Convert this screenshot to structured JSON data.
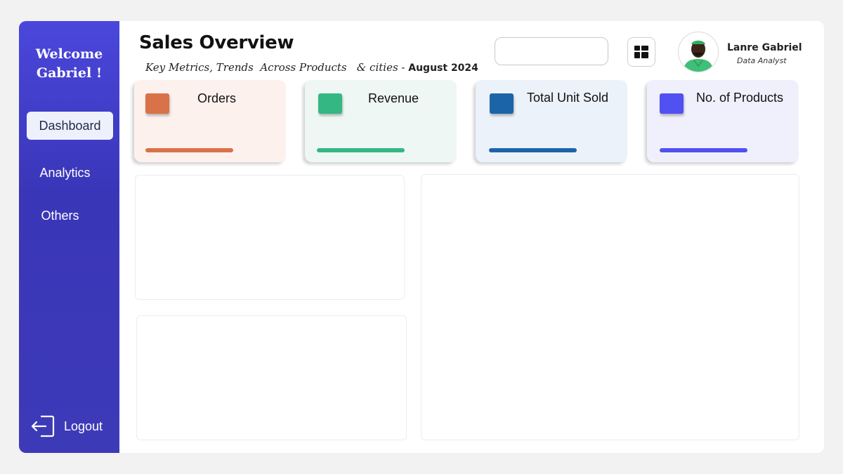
{
  "sidebar": {
    "welcome_line1": "Welcome",
    "welcome_line2": "Gabriel !",
    "items": [
      {
        "label": "Dashboard",
        "active": true
      },
      {
        "label": "Analytics",
        "active": false
      },
      {
        "label": "Others",
        "active": false
      }
    ],
    "logout_label": "Logout",
    "logout_icon": "logout-icon"
  },
  "header": {
    "title": "Sales Overview",
    "subtitle_main": "Key Metrics, Trends  Across Products   & cities - ",
    "subtitle_period": "August 2024",
    "search": {
      "value": "",
      "placeholder": ""
    },
    "grid_icon": "grid-icon"
  },
  "user": {
    "name": "Lanre Gabriel",
    "role": "Data Analyst"
  },
  "kpis": [
    {
      "label": "Orders",
      "accent": "#d97248",
      "bg": "#fdf1ee"
    },
    {
      "label": "Revenue",
      "accent": "#34b783",
      "bg": "#eef7f3"
    },
    {
      "label": "Total Unit Sold",
      "accent": "#1c64a8",
      "bg": "#ecf2fa"
    },
    {
      "label": "No. of Products",
      "accent": "#5150f0",
      "bg": "#f0f0fd"
    }
  ],
  "colors": {
    "sidebar_top": "#4a47dc",
    "sidebar_bottom": "#3d3ab8",
    "page_bg": "#f2f2f2"
  }
}
